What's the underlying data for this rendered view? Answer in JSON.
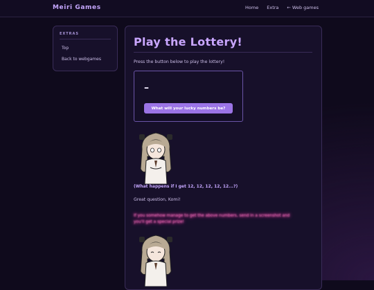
{
  "header": {
    "brand": "Meiri Games",
    "nav": {
      "home": "Home",
      "extra": "Extra",
      "web_games": "← Web games"
    }
  },
  "sidebar": {
    "title": "EXTRAS",
    "items": [
      {
        "label": "Top"
      },
      {
        "label": "Back to webgames"
      }
    ]
  },
  "main": {
    "title": "Play the Lottery!",
    "intro": "Press the button below to play the lottery!",
    "lottery": {
      "result": "–",
      "button_label": "What will your lucky numbers be?"
    },
    "question": "(What happens if I get 12, 12, 12, 12, 12...?)",
    "reply": "Great question, Komi!",
    "secret": "If you somehow manage to get the above numbers, send in a screenshot and you'll get a special prize!"
  },
  "colors": {
    "accent": "#c9a6ff",
    "button": "#9b74e6",
    "glow": "#ff4fb0",
    "background": "#0f0a1c"
  },
  "icons": {
    "character_illustration": "anime-girl-illustration"
  }
}
